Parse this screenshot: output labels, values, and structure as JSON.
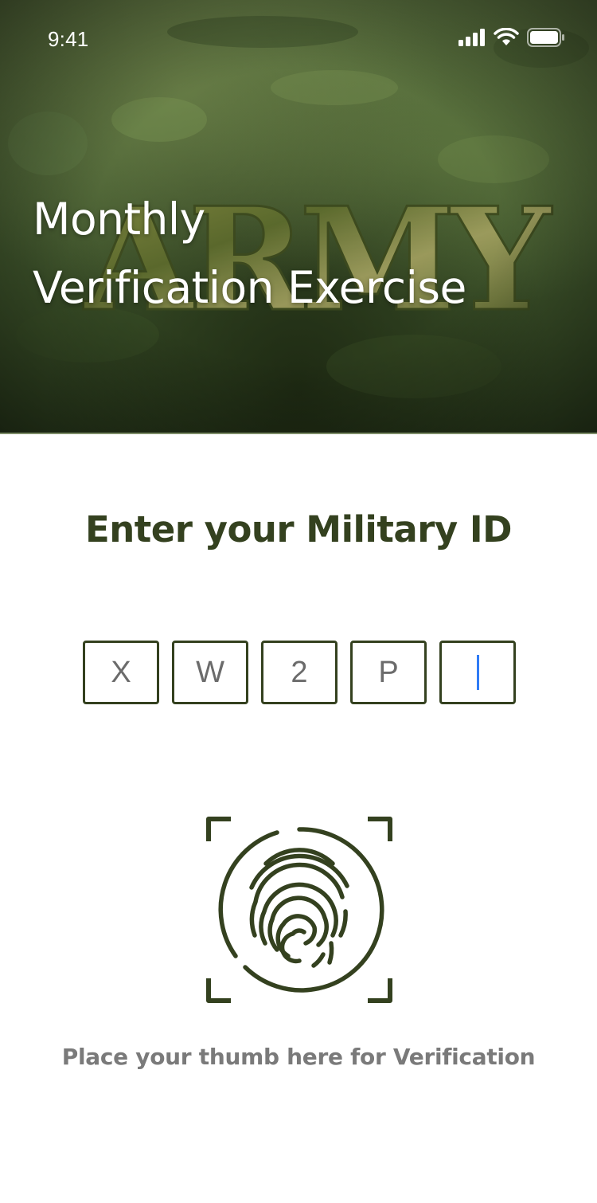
{
  "status_bar": {
    "time": "9:41",
    "icons": [
      "cellular-signal-icon",
      "wifi-icon",
      "battery-icon"
    ]
  },
  "hero": {
    "background_logo": "ARMY",
    "title_line1": "Monthly",
    "title_line2": "Verification Exercise"
  },
  "verification": {
    "heading": "Enter your Military ID",
    "id_characters": [
      "X",
      "W",
      "2",
      "P",
      ""
    ],
    "active_index": 4,
    "fingerprint_icon": "fingerprint-scan-icon",
    "hint": "Place your thumb here for Verification"
  },
  "colors": {
    "accent": "#34411f",
    "hint_text": "#7a7a7a",
    "caret": "#2f7cf6",
    "hero_green": "#4a6134"
  }
}
